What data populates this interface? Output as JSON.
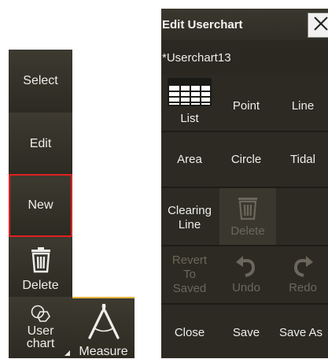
{
  "toolbar": {
    "select_label": "Select",
    "edit_label": "Edit",
    "new_label": "New",
    "delete_label": "Delete",
    "userchart_label_line1": "User",
    "userchart_label_line2": "chart",
    "measure_label": "Measure",
    "selected_item": "New",
    "highlight_color": "#e02020",
    "measure_accent_color": "#e8b640"
  },
  "panel": {
    "title": "Edit Userchart",
    "chart_name": "*Userchart13",
    "buttons": {
      "list": "List",
      "point": "Point",
      "line": "Line",
      "area": "Area",
      "circle": "Circle",
      "tidal": "Tidal",
      "clearing_line_1": "Clearing",
      "clearing_line_2": "Line",
      "delete": "Delete",
      "revert_1": "Revert",
      "revert_2": "To",
      "revert_3": "Saved",
      "undo": "Undo",
      "redo": "Redo",
      "close": "Close",
      "save": "Save",
      "save_as": "Save As"
    },
    "disabled_buttons": [
      "Delete",
      "Revert To Saved",
      "Undo",
      "Redo"
    ]
  }
}
